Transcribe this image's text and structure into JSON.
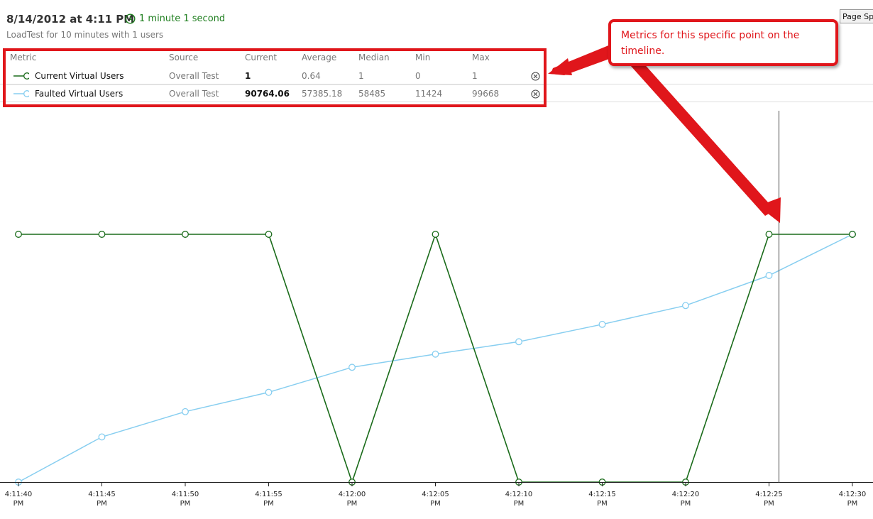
{
  "header": {
    "title": "8/14/2012 at 4:11 PM",
    "duration": "1 minute 1 second",
    "subtitle": "LoadTest for 10 minutes with 1 users",
    "page_button": "Page Speed"
  },
  "metrics_table": {
    "columns": [
      "Metric",
      "Source",
      "Current",
      "Average",
      "Median",
      "Min",
      "Max"
    ],
    "rows": [
      {
        "metric": "Current Virtual Users",
        "source": "Overall Test",
        "current": "1",
        "average": "0.64",
        "median": "1",
        "min": "0",
        "max": "1",
        "color": "#1a6b1a"
      },
      {
        "metric": "Faulted Virtual Users",
        "source": "Overall Test",
        "current": "90764.06",
        "average": "57385.18",
        "median": "58485",
        "min": "11424",
        "max": "99668",
        "color": "#87cef0"
      }
    ]
  },
  "callout": {
    "text": "Metrics for this specific point on the timeline."
  },
  "colors": {
    "accent_red": "#e0161b",
    "series_green": "#1a6b1a",
    "series_blue": "#87cef0"
  },
  "chart_data": {
    "type": "line",
    "x": [
      "4:11:40 PM",
      "4:11:45 PM",
      "4:11:50 PM",
      "4:11:55 PM",
      "4:12:00 PM",
      "4:12:05 PM",
      "4:12:10 PM",
      "4:12:15 PM",
      "4:12:20 PM",
      "4:12:25 PM",
      "4:12:30 PM"
    ],
    "tick_labels": [
      [
        "4:11:40",
        "PM"
      ],
      [
        "4:11:45",
        "PM"
      ],
      [
        "4:11:50",
        "PM"
      ],
      [
        "4:11:55",
        "PM"
      ],
      [
        "4:12:00",
        "PM"
      ],
      [
        "4:12:05",
        "PM"
      ],
      [
        "4:12:10",
        "PM"
      ],
      [
        "4:12:15",
        "PM"
      ],
      [
        "4:12:20",
        "PM"
      ],
      [
        "4:12:25",
        "PM"
      ],
      [
        "4:12:30",
        "PM"
      ]
    ],
    "series": [
      {
        "name": "Current Virtual Users",
        "color": "#1a6b1a",
        "values": [
          1,
          1,
          1,
          1,
          0,
          1,
          0,
          0,
          0,
          1,
          1
        ],
        "scale": [
          0,
          1
        ]
      },
      {
        "name": "Faulted Virtual Users",
        "color": "#87cef0",
        "values": [
          11424,
          27500,
          36500,
          43400,
          52300,
          57000,
          61400,
          67600,
          74300,
          85000,
          99668
        ],
        "scale": [
          11424,
          99668
        ]
      }
    ],
    "cursor_time": "4:12:25.5 PM",
    "grid": false
  }
}
